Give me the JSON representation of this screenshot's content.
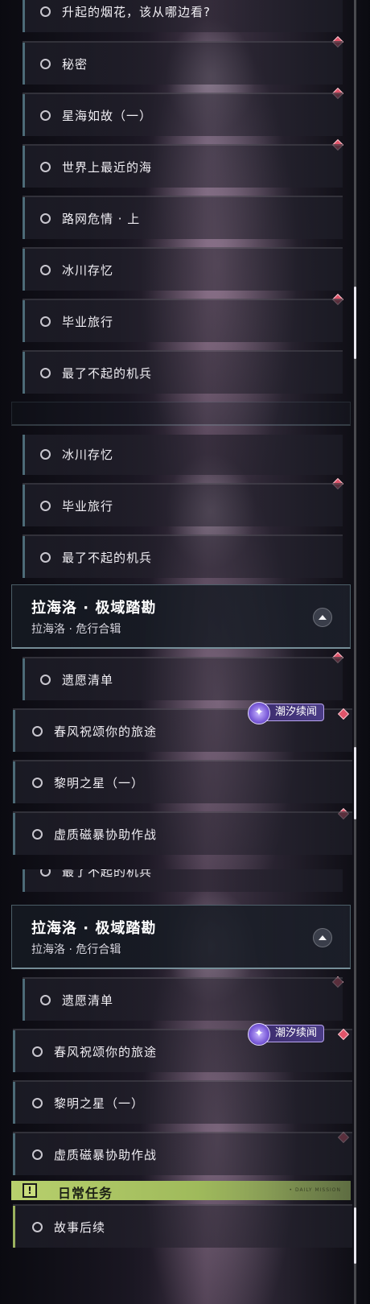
{
  "quests": {
    "q_fireworks": "升起的烟花，该从哪边看?",
    "q_secret": "秘密",
    "q_starsea": "星海如故（一）",
    "q_nearest_sea": "世界上最近的海",
    "q_road_net": "路网危情 · 上",
    "q_glacier": "冰川存忆",
    "q_graduation": "毕业旅行",
    "q_best_mech": "最了不起的机兵",
    "q_wishlist": "遗愿清单",
    "q_spring": "春风祝颂你的旅途",
    "q_dawn": "黎明之星（一）",
    "q_storm": "虚质磁暴协助作战",
    "q_story_after": "故事后续"
  },
  "section_lahailuo": {
    "title": "拉海洛 · 极域踏勘",
    "subtitle": "拉海洛 · 危行合辑"
  },
  "tide_tag": {
    "label": "潮汐续闻"
  },
  "daily": {
    "title": "日常任务",
    "icon_text": "!",
    "tiny_text": "• DAILY MISSION"
  },
  "colors": {
    "diamond": "#e0546a",
    "row_accent": "#4d6b77",
    "daily_accent": "#b8d06d",
    "tag_purple": "#4a3c86"
  },
  "icons": {
    "quest_status": "circle-outline-icon",
    "new_marker": "red-diamond-icon",
    "collapse": "triangle-up-icon",
    "tide": "sparkle-icon",
    "daily": "exclamation-icon"
  }
}
